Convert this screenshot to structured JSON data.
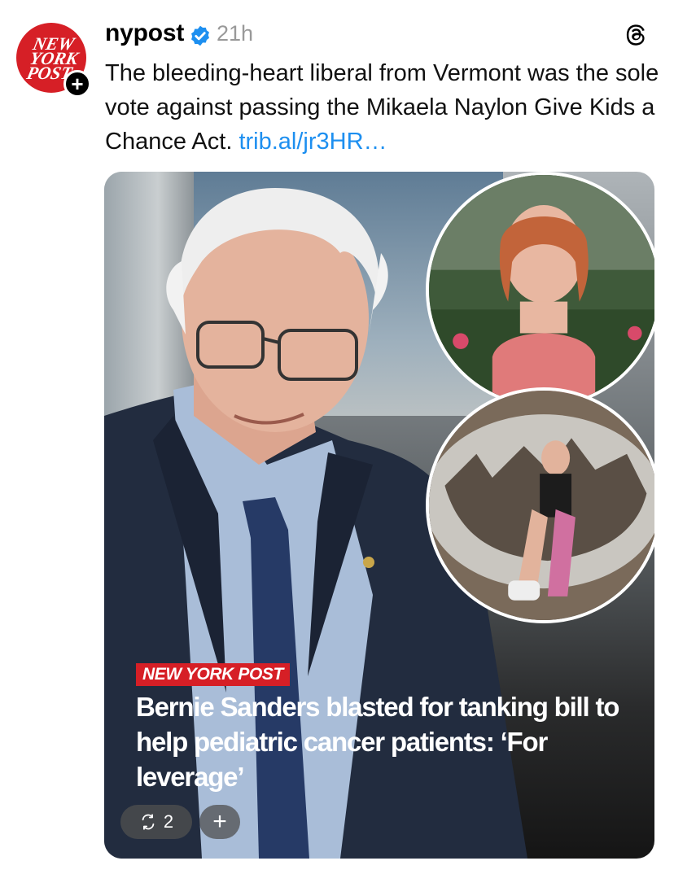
{
  "post": {
    "author": {
      "username": "nypost",
      "avatar_logo_lines": [
        "NEW",
        "YORK",
        "POST"
      ],
      "follow_symbol": "+",
      "verified_icon": "verified-badge-icon",
      "brand_color": "#d61f26"
    },
    "timestamp": "21h",
    "app_icon": "threads-icon",
    "text": "The bleeding-heart liberal from Vermont was the sole vote against passing the Mikaela Naylon Give Kids a Chance Act. ",
    "link_text": "trib.al/jr3HR…",
    "link_color": "#1d8ff0",
    "card": {
      "source_tag": "NEW YORK POST",
      "headline": "Bernie Sanders blasted for tanking bill to help pediatric cancer patients: ‘For leverage’",
      "repost_icon": "repost-icon",
      "repost_count": "2",
      "add_symbol": "+"
    }
  }
}
